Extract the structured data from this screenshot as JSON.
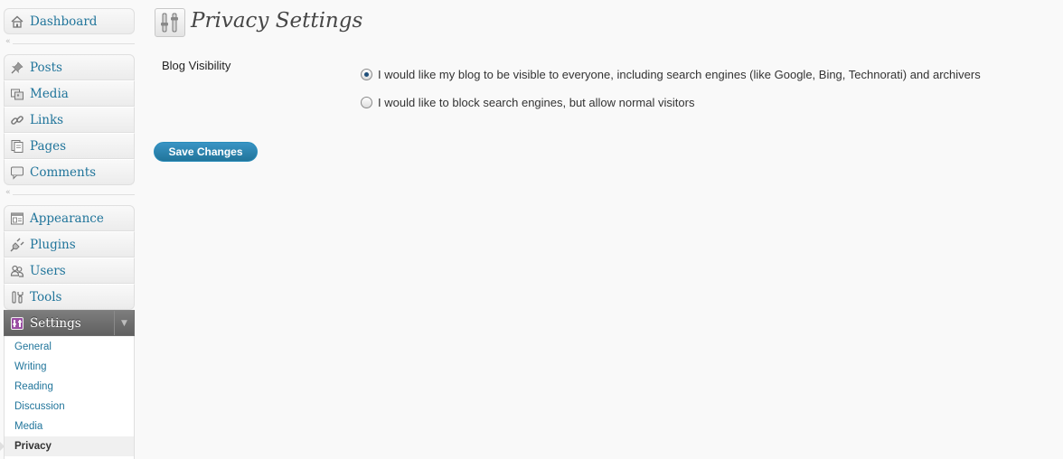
{
  "sidebar": {
    "dashboard": "Dashboard",
    "group1": [
      "Posts",
      "Media",
      "Links",
      "Pages",
      "Comments"
    ],
    "group2": [
      "Appearance",
      "Plugins",
      "Users",
      "Tools"
    ],
    "settings_label": "Settings",
    "submenu": [
      "General",
      "Writing",
      "Reading",
      "Discussion",
      "Media",
      "Privacy"
    ]
  },
  "page": {
    "title": "Privacy Settings",
    "field_label": "Blog Visibility",
    "options": [
      "I would like my blog to be visible to everyone, including search engines (like Google, Bing, Technorati) and archivers",
      "I would like to block search engines, but allow normal visitors"
    ],
    "selected_option": 0,
    "save_label": "Save Changes"
  },
  "colors": {
    "link": "#21759b",
    "button": "#21759b",
    "active_menu": "#6d6d6d"
  }
}
